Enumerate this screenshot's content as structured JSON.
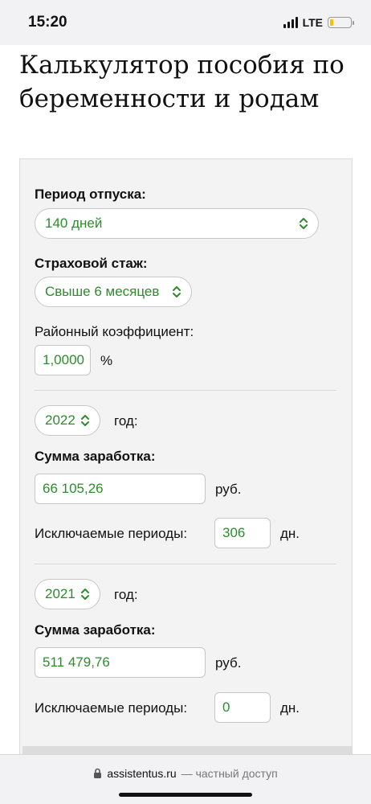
{
  "status_bar": {
    "time": "15:20",
    "network": "LTE",
    "battery_level": 0.15,
    "battery_color": "#f5c200"
  },
  "title": "Калькулятор пособия по беременности и родам",
  "calculator": {
    "leave_period_label": "Период отпуска:",
    "leave_period_value": "140 дней",
    "insurance_label": "Страховой стаж:",
    "insurance_value": "Свыше 6 месяцев",
    "regional_coef_label": "Районный коэффициент:",
    "regional_coef_value": "1,0000",
    "percent_unit": "%",
    "years": [
      {
        "year": "2022",
        "year_unit": "год:",
        "earnings_label": "Сумма заработка:",
        "earnings_value": "66 105,26",
        "currency": "руб.",
        "excluded_label": "Исключаемые периоды:",
        "excluded_value": "306",
        "days_unit": "дн."
      },
      {
        "year": "2021",
        "year_unit": "год:",
        "earnings_label": "Сумма заработка:",
        "earnings_value": "511 479,76",
        "currency": "руб.",
        "excluded_label": "Исключаемые периоды:",
        "excluded_value": "0",
        "days_unit": "дн."
      }
    ]
  },
  "browser": {
    "domain": "assistentus.ru",
    "note": "— частный доступ",
    "lock_icon": "lock-icon"
  },
  "colors": {
    "accent_green": "#2e8b2e",
    "card_background": "#f3f3f3"
  }
}
